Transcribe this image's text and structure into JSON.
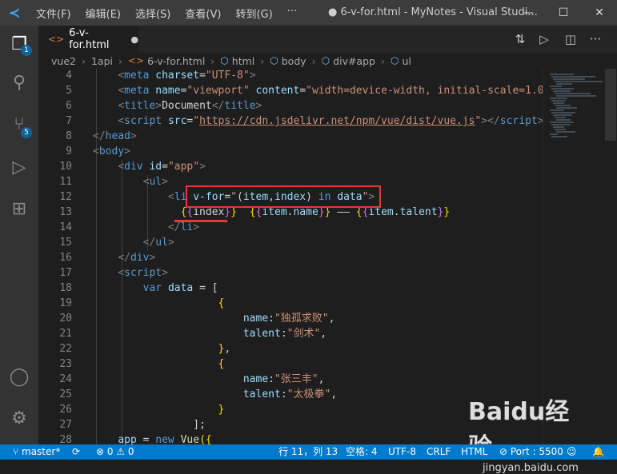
{
  "menu": [
    "文件(F)",
    "编辑(E)",
    "选择(S)",
    "查看(V)",
    "转到(G)",
    "···"
  ],
  "window_title": "● 6-v-for.html - MyNotes - Visual Studi...",
  "window_controls": {
    "minimize": "—",
    "maximize": "☐",
    "close": "✕"
  },
  "tab": {
    "label": "6-v-for.html",
    "modified_dot": "●"
  },
  "breadcrumb": [
    "vue2",
    "1api",
    "6-v-for.html",
    "html",
    "body",
    "div#app",
    "ul"
  ],
  "badges": {
    "explorer": "1",
    "scm": "5"
  },
  "code_lines": [
    {
      "n": "4",
      "html": "    <span class='t-punc'>&lt;</span><span class='t-tag'>meta</span> <span class='t-attr'>charset</span><span class='t-text'>=</span><span class='t-str'>\"UTF-8\"</span><span class='t-punc'>&gt;</span>"
    },
    {
      "n": "5",
      "html": "    <span class='t-punc'>&lt;</span><span class='t-tag'>meta</span> <span class='t-attr'>name</span><span class='t-text'>=</span><span class='t-str'>\"viewport\"</span> <span class='t-attr'>content</span><span class='t-text'>=</span><span class='t-str'>\"width=device-width, initial-scale=1.0\"</span><span class='t-punc'>&gt;</span>"
    },
    {
      "n": "6",
      "html": "    <span class='t-punc'>&lt;</span><span class='t-tag'>title</span><span class='t-punc'>&gt;</span><span class='t-text'>Document</span><span class='t-punc'>&lt;/</span><span class='t-tag'>title</span><span class='t-punc'>&gt;</span>"
    },
    {
      "n": "7",
      "html": "    <span class='t-punc'>&lt;</span><span class='t-tag'>script</span> <span class='t-attr'>src</span><span class='t-text'>=</span><span class='t-str'>\"</span><span class='t-link'>https://cdn.jsdelivr.net/npm/vue/dist/vue.js</span><span class='t-str'>\"</span><span class='t-punc'>&gt;&lt;/</span><span class='t-tag'>script</span><span class='t-punc'>&gt;</span>"
    },
    {
      "n": "8",
      "html": "<span class='t-punc'>&lt;/</span><span class='t-tag'>head</span><span class='t-punc'>&gt;</span>"
    },
    {
      "n": "9",
      "html": "<span class='t-punc'>&lt;</span><span class='t-tag'>body</span><span class='t-punc'>&gt;</span>"
    },
    {
      "n": "10",
      "html": "    <span class='t-punc'>&lt;</span><span class='t-tag'>div</span> <span class='t-attr'>id</span><span class='t-text'>=</span><span class='t-str'>\"app\"</span><span class='t-punc'>&gt;</span>"
    },
    {
      "n": "11",
      "html": "        <span class='t-punc'>&lt;</span><span class='t-tag'>ul</span><span class='t-punc'>&gt;</span>"
    },
    {
      "n": "12",
      "html": "            <span class='t-punc'>&lt;</span><span class='t-tag'>li</span> <span class='t-attr'>v-for</span><span class='t-text'>=</span><span class='t-str'>\"</span><span class='t-text'>(</span><span class='t-var'>item</span><span class='t-text'>,</span><span class='t-var'>index</span><span class='t-text'>) </span><span class='t-kw'>in</span><span class='t-text'> </span><span class='t-var'>data</span><span class='t-str'>\"</span><span class='t-punc'>&gt;</span>"
    },
    {
      "n": "13",
      "html": "              <span class='t-brace'>{</span><span class='t-brace2'>{</span><span class='t-text'>index</span><span class='t-brace2'>}</span><span class='t-brace'>}</span>  <span class='t-brace'>{</span><span class='t-brace2'>{</span><span class='t-var'>item</span><span class='t-text'>.</span><span class='t-var'>name</span><span class='t-brace2'>}</span><span class='t-brace'>}</span><span class='t-text'> —— </span><span class='t-brace'>{</span><span class='t-brace2'>{</span><span class='t-var'>item</span><span class='t-text'>.</span><span class='t-var'>talent</span><span class='t-brace2'>}</span><span class='t-brace'>}</span>"
    },
    {
      "n": "14",
      "html": "            <span class='t-punc'>&lt;/</span><span class='t-tag'>li</span><span class='t-punc'>&gt;</span>"
    },
    {
      "n": "15",
      "html": "        <span class='t-punc'>&lt;/</span><span class='t-tag'>ul</span><span class='t-punc'>&gt;</span>"
    },
    {
      "n": "16",
      "html": "    <span class='t-punc'>&lt;/</span><span class='t-tag'>div</span><span class='t-punc'>&gt;</span>"
    },
    {
      "n": "17",
      "html": "    <span class='t-punc'>&lt;</span><span class='t-tag'>script</span><span class='t-punc'>&gt;</span>"
    },
    {
      "n": "18",
      "html": "        <span class='t-kw'>var</span> <span class='t-var'>data</span><span class='t-text'> = [</span>"
    },
    {
      "n": "19",
      "html": "                    <span class='t-brace'>{</span>"
    },
    {
      "n": "20",
      "html": "                        <span class='t-var'>name</span><span class='t-text'>:</span><span class='t-str'>\"独孤求败\"</span><span class='t-text'>,</span>"
    },
    {
      "n": "21",
      "html": "                        <span class='t-var'>talent</span><span class='t-text'>:</span><span class='t-str'>\"剑术\"</span><span class='t-text'>,</span>"
    },
    {
      "n": "22",
      "html": "                    <span class='t-brace'>}</span><span class='t-text'>,</span>"
    },
    {
      "n": "23",
      "html": "                    <span class='t-brace'>{</span>"
    },
    {
      "n": "24",
      "html": "                        <span class='t-var'>name</span><span class='t-text'>:</span><span class='t-str'>\"张三丰\"</span><span class='t-text'>,</span>"
    },
    {
      "n": "25",
      "html": "                        <span class='t-var'>talent</span><span class='t-text'>:</span><span class='t-str'>\"太极拳\"</span><span class='t-text'>,</span>"
    },
    {
      "n": "26",
      "html": "                    <span class='t-brace'>}</span>"
    },
    {
      "n": "27",
      "html": "                <span class='t-text'>];</span>"
    },
    {
      "n": "28",
      "html": "    <span class='t-var'>app</span><span class='t-text'> = </span><span class='t-kw'>new</span> <span class='t-func'>Vue</span><span class='t-brace'>({</span>"
    }
  ],
  "status": {
    "branch": "master*",
    "sync": "⟳",
    "problems": "⊗ 0 ⚠ 0",
    "position": "行 11，列 13",
    "spaces": "空格: 4",
    "encoding": "UTF-8",
    "eol": "CRLF",
    "language": "HTML",
    "port": "⊘ Port : 5500"
  },
  "watermark": {
    "logo": "Baidu经验",
    "url": "jingyan.baidu.com"
  }
}
